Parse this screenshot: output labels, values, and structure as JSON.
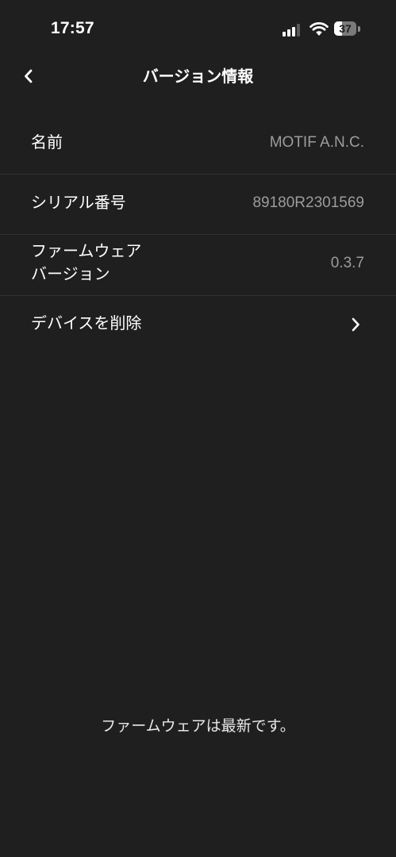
{
  "status_bar": {
    "time": "17:57",
    "signal_icon": "cellular-signal-icon",
    "wifi_icon": "wifi-icon",
    "battery_level": "37",
    "battery_fraction": 0.37
  },
  "nav": {
    "back_icon": "chevron-left-icon",
    "title": "バージョン情報"
  },
  "rows": [
    {
      "label": "名前",
      "value": "MOTIF A.N.C."
    },
    {
      "label": "シリアル番号",
      "value": "89180R2301569"
    },
    {
      "label_line1": "ファームウェア",
      "label_line2": "バージョン",
      "value": "0.3.7"
    },
    {
      "label": "デバイスを削除",
      "icon": "chevron-right-icon"
    }
  ],
  "footer": {
    "message": "ファームウェアは最新です。"
  },
  "colors": {
    "background": "#1f1f1f",
    "divider": "#303030",
    "value_text": "#9c9c9c"
  }
}
